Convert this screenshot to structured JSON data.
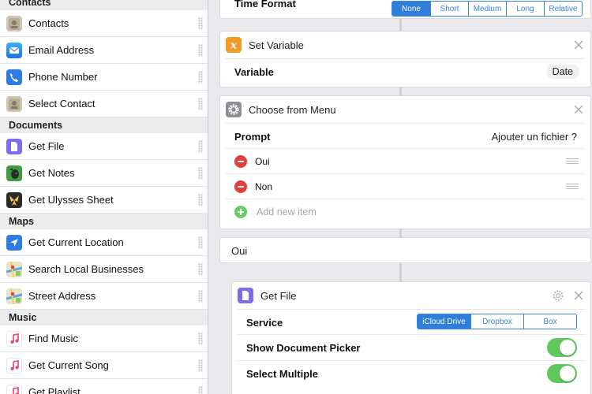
{
  "colors": {
    "accent": "#2e7fd9",
    "toggle_on": "#5fc85e",
    "remove": "#e23e3a",
    "add": "#63cf62"
  },
  "sidebar": {
    "sections": [
      {
        "title": "Contacts",
        "items": [
          {
            "label": "Contacts",
            "icon": "contacts-icon"
          },
          {
            "label": "Email Address",
            "icon": "mail-icon"
          },
          {
            "label": "Phone Number",
            "icon": "phone-icon"
          },
          {
            "label": "Select Contact",
            "icon": "contacts-icon"
          }
        ]
      },
      {
        "title": "Documents",
        "items": [
          {
            "label": "Get File",
            "icon": "file-icon"
          },
          {
            "label": "Get Notes",
            "icon": "evernote-icon"
          },
          {
            "label": "Get Ulysses Sheet",
            "icon": "ulysses-icon"
          }
        ]
      },
      {
        "title": "Maps",
        "items": [
          {
            "label": "Get Current Location",
            "icon": "location-arrow-icon"
          },
          {
            "label": "Search Local Businesses",
            "icon": "maps-icon"
          },
          {
            "label": "Street Address",
            "icon": "maps-icon"
          }
        ]
      },
      {
        "title": "Music",
        "items": [
          {
            "label": "Find Music",
            "icon": "music-note-icon"
          },
          {
            "label": "Get Current Song",
            "icon": "music-note-icon"
          },
          {
            "label": "Get Playlist",
            "icon": "music-note-icon"
          }
        ]
      }
    ]
  },
  "workflow": {
    "time_format": {
      "label": "Time Format",
      "options": [
        "None",
        "Short",
        "Medium",
        "Long",
        "Relative"
      ],
      "selected": "None"
    },
    "set_variable": {
      "title": "Set Variable",
      "icon": "variable-x-icon",
      "param_label": "Variable",
      "param_value": "Date"
    },
    "choose_menu": {
      "title": "Choose from Menu",
      "icon": "gear-icon",
      "prompt_label": "Prompt",
      "prompt_value": "Ajouter un fichier ?",
      "items": [
        "Oui",
        "Non"
      ],
      "add_placeholder": "Add new item"
    },
    "branch_label": "Oui",
    "get_file": {
      "title": "Get File",
      "icon": "file-icon",
      "service_label": "Service",
      "service_options": [
        "iCloud Drive",
        "Dropbox",
        "Box"
      ],
      "service_selected": "iCloud Drive",
      "picker_label": "Show Document Picker",
      "picker_on": true,
      "multiple_label": "Select Multiple",
      "multiple_on": true
    }
  }
}
